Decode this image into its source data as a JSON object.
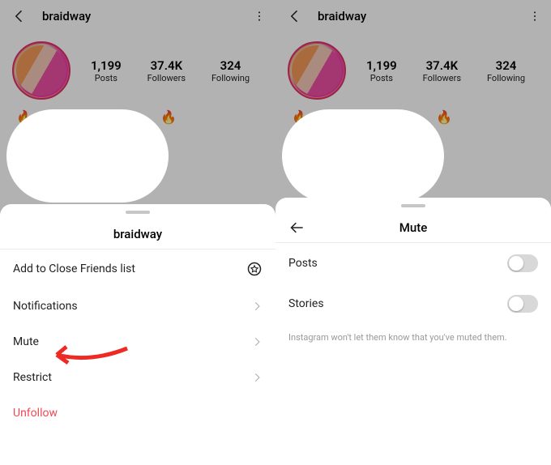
{
  "profile": {
    "username": "braidway",
    "stats": {
      "posts": {
        "value": "1,199",
        "label": "Posts"
      },
      "followers": {
        "value": "37.4K",
        "label": "Followers"
      },
      "following": {
        "value": "324",
        "label": "Following"
      }
    }
  },
  "left_sheet": {
    "title": "braidway",
    "items": {
      "close_friends": "Add to Close Friends list",
      "notifications": "Notifications",
      "mute": "Mute",
      "restrict": "Restrict",
      "unfollow": "Unfollow"
    }
  },
  "right_sheet": {
    "title": "Mute",
    "items": {
      "posts": "Posts",
      "stories": "Stories"
    },
    "hint": "Instagram won't let them know that you've muted them."
  }
}
